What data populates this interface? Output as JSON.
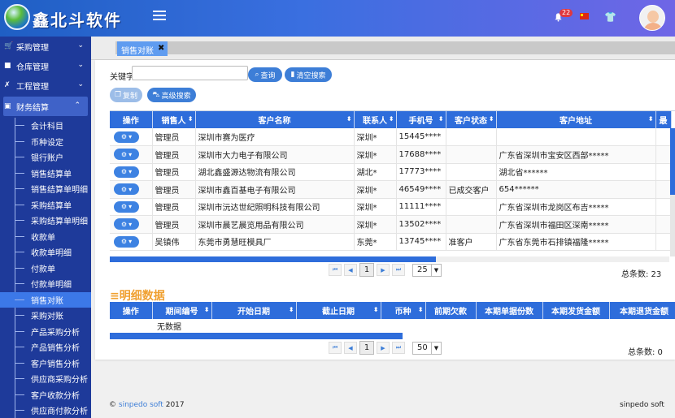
{
  "app": {
    "title": "鑫北斗软件",
    "notification_count": "22"
  },
  "colors": {
    "header_start": "#1f5fc4",
    "header_end": "#6f66e6",
    "sidebar": "#1e3a9a",
    "accent": "#2e6ddb",
    "active_item": "#3c78e8",
    "detail_title": "#f0a030"
  },
  "sidebar": {
    "groups": [
      {
        "label": "采购管理",
        "icon": "cart-icon"
      },
      {
        "label": "仓库管理",
        "icon": "box-icon"
      },
      {
        "label": "工程管理",
        "icon": "wrench-icon"
      },
      {
        "label": "财务结算",
        "icon": "wallet-icon"
      }
    ],
    "items": [
      "会计科目",
      "币种设定",
      "银行账户",
      "销售结算单",
      "销售结算单明细",
      "采购结算单",
      "采购结算单明细",
      "收款单",
      "收款单明细",
      "付款单",
      "付款单明细",
      "销售对账",
      "采购对账",
      "产品采购分析",
      "产品销售分析",
      "客户销售分析",
      "供应商采购分析",
      "客户收款分析",
      "供应商付款分析"
    ],
    "active_item": "销售对账"
  },
  "tabs": [
    {
      "label": "销售对账",
      "close": "✖"
    }
  ],
  "search": {
    "label": "关键字",
    "value": "",
    "query_button": "查询",
    "clear_button": "清空搜索"
  },
  "toolbar": {
    "copy_button": "复制",
    "advanced_button": "高级搜索"
  },
  "customer_table": {
    "columns": [
      "操作",
      "销售人",
      "客户名称",
      "联系人",
      "手机号",
      "客户状态",
      "客户地址",
      "最"
    ],
    "rows": [
      {
        "sales": "管理员",
        "name": "深圳市赛为医疗",
        "contact": "深圳*",
        "phone": "15445****",
        "status": "",
        "address": ""
      },
      {
        "sales": "管理员",
        "name": "深圳市大力电子有限公司",
        "contact": "深圳*",
        "phone": "17688****",
        "status": "",
        "address": "广东省深圳市宝安区西部*****"
      },
      {
        "sales": "管理员",
        "name": "湖北鑫盛源达物流有限公司",
        "contact": "湖北*",
        "phone": "17773****",
        "status": "",
        "address": "湖北省******"
      },
      {
        "sales": "管理员",
        "name": "深圳市鑫百基电子有限公司",
        "contact": "深圳*",
        "phone": "46549****",
        "status": "已成交客户",
        "address": "654******"
      },
      {
        "sales": "管理员",
        "name": "深圳市沅达世纪照明科技有限公司",
        "contact": "深圳*",
        "phone": "11111****",
        "status": "",
        "address": "广东省深圳市龙岗区布吉*****"
      },
      {
        "sales": "管理员",
        "name": "深圳市晨艺晨览用品有限公司",
        "contact": "深圳*",
        "phone": "13502****",
        "status": "",
        "address": "广东省深圳市福田区深南*****"
      },
      {
        "sales": "吴镇伟",
        "name": "东莞市勇慧旺模具厂",
        "contact": "东莞*",
        "phone": "13745****",
        "status": "准客户",
        "address": "广东省东莞市石排镇福隆*****"
      }
    ],
    "pagination": {
      "current_page": "1",
      "page_size": "25",
      "total": "总条数: 23"
    }
  },
  "detail": {
    "title": "明细数据",
    "columns": [
      "操作",
      "期间编号",
      "开始日期",
      "截止日期",
      "币种",
      "前期欠款",
      "本期单据份数",
      "本期发货金额",
      "本期退货金额"
    ],
    "empty_text": "无数据",
    "pagination": {
      "current_page": "1",
      "page_size": "50",
      "total": "总条数: 0"
    }
  },
  "footer": {
    "copyright": "©",
    "company_link": "sinpedo soft",
    "year": "2017",
    "right": "sinpedo soft"
  }
}
